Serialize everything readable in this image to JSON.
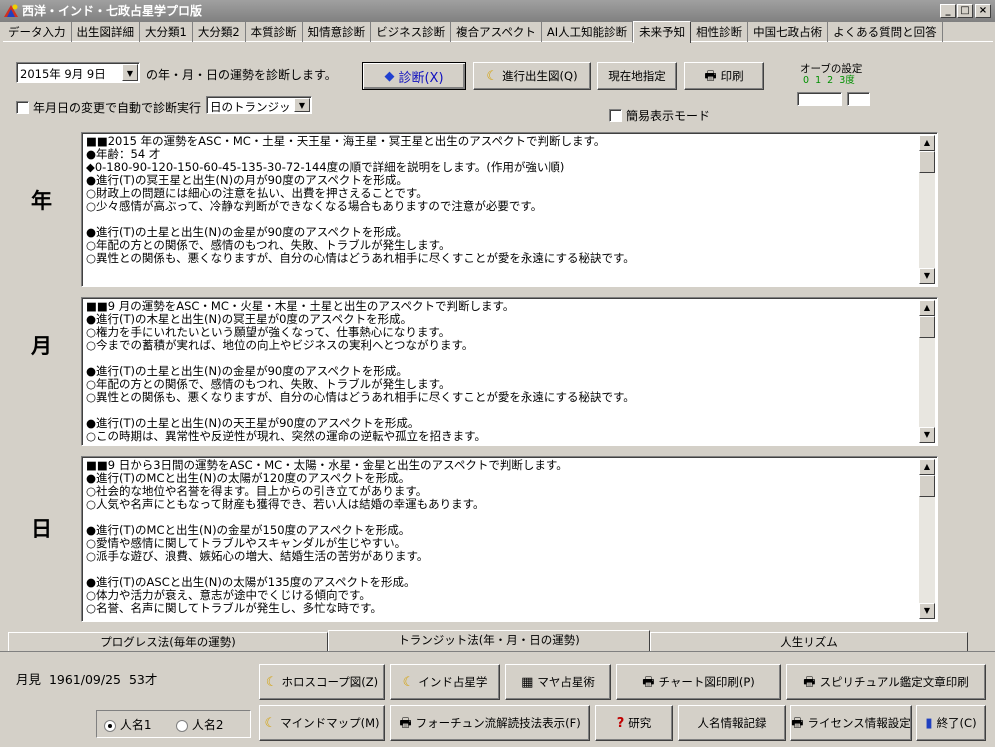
{
  "window": {
    "title": "西洋・インド・七政占星学プロ版"
  },
  "tabs": [
    "データ入力",
    "出生図詳細",
    "大分類1",
    "大分類2",
    "本質診断",
    "知情意診断",
    "ビジネス診断",
    "複合アスペクト",
    "AI人工知能診断",
    "未来予知",
    "相性診断",
    "中国七政占術",
    "よくある質問と回答"
  ],
  "active_tab": "未来予知",
  "date": {
    "value": "2015年  9月  9日",
    "suffix": "の年・月・日の運勢を診断します。"
  },
  "auto_check": {
    "label": "年月日の変更で自動で診断実行"
  },
  "transit_select": {
    "value": "日のトランジット"
  },
  "buttons": {
    "diagnose": "診断(X)",
    "progress_chart": "進行出生図(Q)",
    "current_loc": "現在地指定",
    "print": "印刷"
  },
  "orb": {
    "title": "オーブの設定",
    "scale": "0  1  2  3度"
  },
  "simple_mode": {
    "label": "簡易表示モード"
  },
  "sections": {
    "year": {
      "label": "年",
      "lines": [
        "■■2015 年の運勢をASC・MC・土星・天王星・海王星・冥王星と出生のアスペクトで判断します。",
        "●年齢：54 才",
        "◆0-180-90-120-150-60-45-135-30-72-144度の順で詳細を説明をします。(作用が強い順)",
        "●進行(T)の冥王星と出生(N)の月が90度のアスペクトを形成。",
        "○財政上の問題には細心の注意を払い、出費を押さえることです。",
        "○少々感情が高ぶって、冷静な判断ができなくなる場合もありますので注意が必要です。",
        "",
        "●進行(T)の土星と出生(N)の金星が90度のアスペクトを形成。",
        "○年配の方との関係で、感情のもつれ、失敗、トラブルが発生します。",
        "○異性との関係も、悪くなりますが、自分の心情はどうあれ相手に尽くすことが愛を永遠にする秘訣です。"
      ]
    },
    "month": {
      "label": "月",
      "lines": [
        "■■9 月の運勢をASC・MC・火星・木星・土星と出生のアスペクトで判断します。",
        "●進行(T)の木星と出生(N)の冥王星が0度のアスペクトを形成。",
        "○権力を手にいれたいという願望が強くなって、仕事熱心になります。",
        "○今までの蓄積が実れば、地位の向上やビジネスの実利へとつながります。",
        "",
        "●進行(T)の土星と出生(N)の金星が90度のアスペクトを形成。",
        "○年配の方との関係で、感情のもつれ、失敗、トラブルが発生します。",
        "○異性との関係も、悪くなりますが、自分の心情はどうあれ相手に尽くすことが愛を永遠にする秘訣です。",
        "",
        "●進行(T)の土星と出生(N)の天王星が90度のアスペクトを形成。",
        "○この時期は、異常性や反逆性が現れ、突然の運命の逆転や孤立を招きます。"
      ]
    },
    "day": {
      "label": "日",
      "lines": [
        "■■9 日から3日間の運勢をASC・MC・太陽・水星・金星と出生のアスペクトで判断します。",
        "●進行(T)のMCと出生(N)の太陽が120度のアスペクトを形成。",
        "○社会的な地位や名誉を得ます。目上からの引き立てがあります。",
        "○人気や名声にともなって財産も獲得でき、若い人は結婚の幸運もあります。",
        "",
        "●進行(T)のMCと出生(N)の金星が150度のアスペクトを形成。",
        "○愛情や感情に関してトラブルやスキャンダルが生じやすい。",
        "○派手な遊び、浪費、嫉妬心の増大、結婚生活の苦労があります。",
        "",
        "●進行(T)のASCと出生(N)の太陽が135度のアスペクトを形成。",
        "○体力や活力が衰え、意志が途中でくじける傾向です。",
        "○名誉、名声に関してトラブルが発生し、多忙な時です。"
      ]
    }
  },
  "bottom_tabs": [
    "プログレス法(毎年の運勢)",
    "トランジット法(年・月・日の運勢)",
    "人生リズム"
  ],
  "active_bottom_tab": "トランジット法(年・月・日の運勢)",
  "person": {
    "info": "月見  1961/09/25  53才"
  },
  "radios": {
    "name1": "人名1",
    "name2": "人名2"
  },
  "footer_buttons": {
    "horoscope": "ホロスコープ図(Z)",
    "indian": "インド占星学",
    "maya": "マヤ占星術",
    "chart_print": "チャート図印刷(P)",
    "spiritual_print": "スピリチュアル鑑定文章印刷",
    "mindmap": "マインドマップ(M)",
    "fortune": "フォーチュン流解読技法表示(F)",
    "research": "研究",
    "person_record": "人名情報記録",
    "license": "ライセンス情報設定",
    "exit": "終了(C)"
  }
}
